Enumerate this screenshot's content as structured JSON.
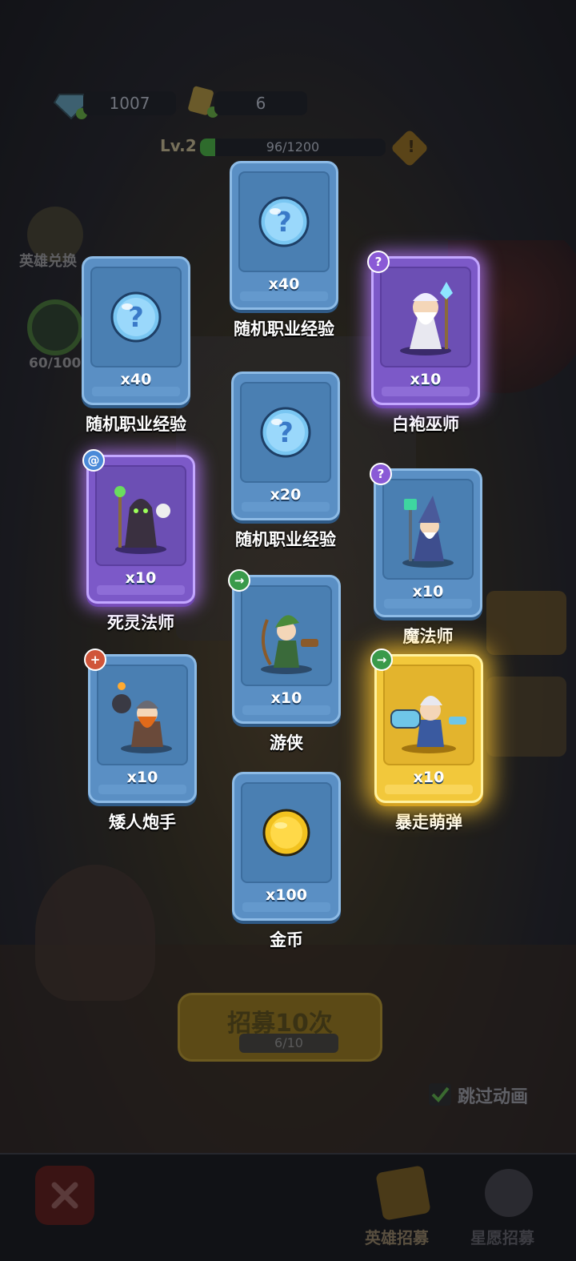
{
  "hud": {
    "gems": "1007",
    "tickets": "6",
    "level": "Lv.2",
    "xp_text": "96/1200",
    "xp_fraction": 0.08,
    "warn": "!"
  },
  "side": {
    "exchange_label": "英雄兑换",
    "progress_label": "60/100"
  },
  "cards": [
    {
      "id": "c1",
      "qty": "x40",
      "name": "随机职业经验",
      "tier": "blue",
      "icon": "exp-bubble-icon"
    },
    {
      "id": "c2",
      "qty": "x40",
      "name": "随机职业经验",
      "tier": "blue",
      "icon": "exp-bubble-icon"
    },
    {
      "id": "c3",
      "qty": "x10",
      "name": "白袍巫师",
      "tier": "purple",
      "icon": "white-wizard-icon",
      "badge": "?"
    },
    {
      "id": "c4",
      "qty": "x20",
      "name": "随机职业经验",
      "tier": "blue",
      "icon": "exp-bubble-icon"
    },
    {
      "id": "c5",
      "qty": "x10",
      "name": "死灵法师",
      "tier": "purple",
      "icon": "necromancer-icon",
      "badge": "@"
    },
    {
      "id": "c6",
      "qty": "x10",
      "name": "魔法师",
      "tier": "blue",
      "icon": "mage-icon",
      "badge": "?"
    },
    {
      "id": "c7",
      "qty": "x10",
      "name": "游侠",
      "tier": "blue",
      "icon": "ranger-icon",
      "badge": "→"
    },
    {
      "id": "c8",
      "qty": "x10",
      "name": "矮人炮手",
      "tier": "blue",
      "icon": "dwarf-gunner-icon",
      "badge": "+"
    },
    {
      "id": "c9",
      "qty": "x10",
      "name": "暴走萌弹",
      "tier": "gold",
      "icon": "rampage-gunner-icon",
      "badge": "→"
    },
    {
      "id": "c10",
      "qty": "x100",
      "name": "金币",
      "tier": "blue",
      "icon": "gold-coin-icon"
    }
  ],
  "recruit": {
    "label": "招募10次",
    "progress": "6/10"
  },
  "skip_label": "跳过动画",
  "tabs": {
    "hero_recruit": "英雄招募",
    "star_recruit": "星愿招募"
  },
  "colors": {
    "card_blue": "#5a8fc4",
    "card_purple": "#7c59c8",
    "card_gold": "#f2c83b"
  }
}
